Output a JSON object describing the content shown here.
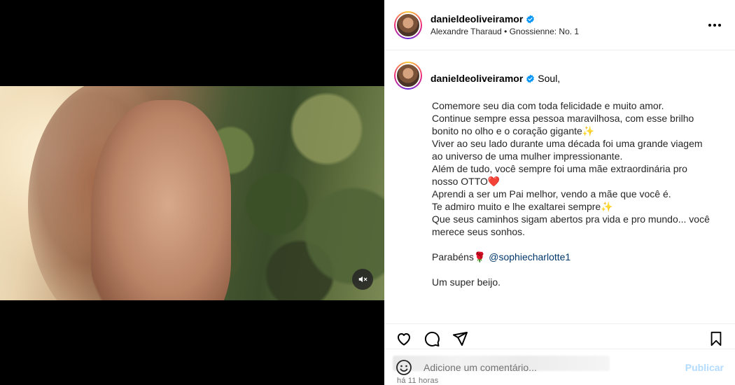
{
  "header": {
    "username": "danieldeoliveiramor",
    "audio": "Alexandre Tharaud • Gnossienne: No. 1",
    "more_icon": "more-horizontal-icon"
  },
  "caption": {
    "username": "danieldeoliveiramor",
    "first": "Soul,",
    "lines": [
      "Comemore seu dia com toda felicidade e muito amor.",
      "Continue sempre essa pessoa maravilhosa, com esse brilho",
      "bonito no olho e o coração gigante✨",
      "Viver ao seu lado durante uma década foi uma grande viagem",
      "ao universo de uma mulher impressionante.",
      "Além de tudo, você sempre foi uma mãe extraordinária pro",
      "nosso OTTO❤️",
      "Aprendi a ser um Pai melhor, vendo a mãe que você é.",
      "Te admiro muito e lhe exaltarei sempre✨",
      "Que seus caminhos sigam abertos pra vida e pro mundo... você",
      "merece seus sonhos."
    ],
    "parabens": "Parabéns🌹",
    "mention": "@sophiecharlotte1",
    "closing": "Um super beijo."
  },
  "actions": {
    "like_icon": "heart-icon",
    "comment_icon": "comment-icon",
    "share_icon": "share-icon",
    "save_icon": "bookmark-icon"
  },
  "post": {
    "time": "há 11 horas"
  },
  "comment": {
    "placeholder": "Adicione um comentário...",
    "post_label": "Publicar"
  },
  "colors": {
    "verified": "#0095f6",
    "link": "#00376b",
    "post_disabled": "#b3dbff"
  }
}
